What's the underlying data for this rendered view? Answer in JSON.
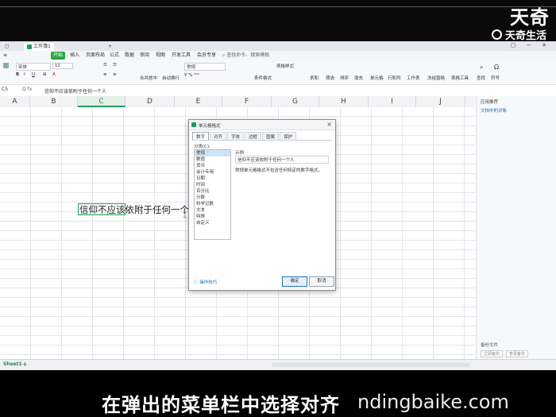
{
  "watermark": {
    "top_text": "天奇",
    "logo_text": "天奇生活",
    "bottom_text": "ndingbaike.com"
  },
  "subtitle": "在弹出的菜单栏中选择对齐",
  "window": {
    "tab_title": "工作簿1",
    "tab_add": "+",
    "controls": "▢ ─ ✕"
  },
  "menu": {
    "items": [
      "开始",
      "插入",
      "页面布局",
      "公式",
      "数据",
      "审阅",
      "视图",
      "开发工具",
      "会员专享"
    ],
    "active": "开始",
    "search": "查找命令、搜索模板"
  },
  "ribbon": {
    "font_name": "宋体",
    "font_size": "11",
    "format_label": "常规",
    "groups": [
      "合并居中",
      "自动换行",
      "条件格式",
      "表格样式",
      "求和",
      "筛选",
      "排序",
      "填充",
      "单元格",
      "行和列",
      "工作表",
      "冻结窗格",
      "表格工具",
      "查找",
      "符号"
    ]
  },
  "formula_bar": {
    "name_box": "C5",
    "fx": "Q  fx",
    "content": "信仰不应该依附于任何一个人"
  },
  "columns": [
    "A",
    "B",
    "C",
    "D",
    "E",
    "F",
    "G",
    "H",
    "I",
    "J"
  ],
  "selected_column": "C",
  "cell": {
    "text": "信仰不应该依附于任何一个人"
  },
  "right_pane": {
    "title": "应用推荐",
    "link": "文档中的对象",
    "bottom": "备份文件",
    "buttons": [
      "立即备份",
      "查看备份"
    ]
  },
  "sheet": {
    "tab": "Sheet1",
    "add": "+"
  },
  "dialog": {
    "title": "单元格格式",
    "close": "×",
    "tabs": [
      "数字",
      "对齐",
      "字体",
      "边框",
      "图案",
      "保护"
    ],
    "active_tab": "数字",
    "category_label": "分类(C):",
    "categories": [
      "常规",
      "数值",
      "货币",
      "会计专用",
      "日期",
      "时间",
      "百分比",
      "分数",
      "科学记数",
      "文本",
      "特殊",
      "自定义"
    ],
    "active_category": "常规",
    "sample_label": "示例",
    "sample_value": "信仰不应该依附于任何一个人",
    "description": "常规单元格格式不包含任何特定的数字格式。",
    "tip": "操作技巧",
    "ok": "确定",
    "cancel": "取消"
  }
}
